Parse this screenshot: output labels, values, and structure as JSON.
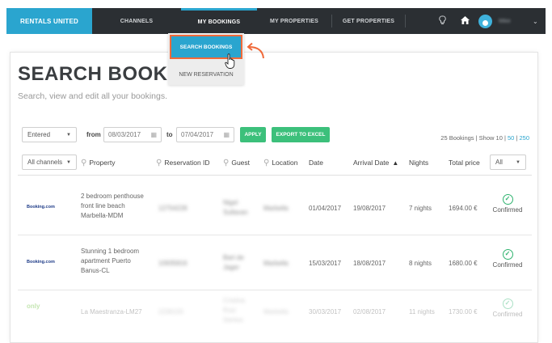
{
  "nav": {
    "brand": "RENTALS UNITED",
    "items": [
      "CHANNELS",
      "MY BOOKINGS",
      "MY PROPERTIES",
      "GET PROPERTIES"
    ],
    "user": "Mike"
  },
  "dropdown": {
    "search": "SEARCH BOOKINGS",
    "new": "NEW RESERVATION"
  },
  "page": {
    "title": "SEARCH BOOKINGS",
    "subtitle": "Search, view and edit all your bookings."
  },
  "filters": {
    "date_type": "Entered",
    "from_label": "from",
    "from_date": "08/03/2017",
    "to_label": "to",
    "to_date": "07/04/2017",
    "apply": "APPLY",
    "export": "EXPORT TO EXCEL",
    "count": "25 Bookings | Show 10 |",
    "show50": "50",
    "sep": "|",
    "show250": "250"
  },
  "table": {
    "channel_select": "All channels",
    "status_select": "All",
    "headers": {
      "property": "Property",
      "reservation": "Reservation ID",
      "guest": "Guest",
      "location": "Location",
      "date": "Date",
      "arrival": "Arrival Date",
      "nights": "Nights",
      "total": "Total price"
    },
    "rows": [
      {
        "channel": "Booking.com",
        "property": [
          "2 bedroom penthouse",
          "front line beach",
          "Marbella-MDM"
        ],
        "reservation": "12754228",
        "guest": [
          "Nigel",
          "Sullavan"
        ],
        "location": "Marbella",
        "date": "01/04/2017",
        "arrival": "19/08/2017",
        "nights": "7 nights",
        "total": "1694.00 €",
        "status": "Confirmed"
      },
      {
        "channel": "Booking.com",
        "property": [
          "Stunning 1 bedroom",
          "apartment Puerto",
          "Banus-CL"
        ],
        "reservation": "10935816",
        "guest": [
          "Bart de",
          "Jager"
        ],
        "location": "Marbella",
        "date": "15/03/2017",
        "arrival": "18/08/2017",
        "nights": "8 nights",
        "total": "1680.00 €",
        "status": "Confirmed"
      },
      {
        "channel": "only",
        "property": [
          "La Maestranza-LM27"
        ],
        "reservation": "2236155",
        "guest": [
          "Cristina",
          "Ruiz",
          "Santos"
        ],
        "location": "Marbella",
        "date": "30/03/2017",
        "arrival": "02/08/2017",
        "nights": "11 nights",
        "total": "1730.00 €",
        "status": "Confirmed"
      }
    ]
  },
  "colors": {
    "accent": "#2aa5cf",
    "nav_bg": "#2b2f33",
    "green": "#3cc07b",
    "highlight": "#f06a3a"
  }
}
